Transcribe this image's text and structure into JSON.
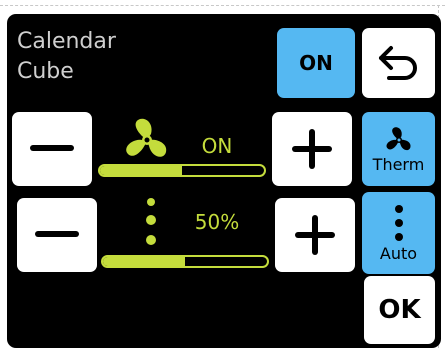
{
  "header": {
    "title": "Calendar\nCube"
  },
  "top_buttons": {
    "power_label": "ON"
  },
  "fan_row": {
    "status": "ON",
    "level_fraction": 0.5
  },
  "mode_row": {
    "status": "50%",
    "level_fraction": 0.5
  },
  "side_buttons": {
    "therm_label": "Therm",
    "auto_label": "Auto"
  },
  "footer": {
    "ok_label": "OK"
  },
  "colors": {
    "accent": "#c4dc3c",
    "highlight": "#55b8f2",
    "background": "#000000",
    "button": "#ffffff"
  },
  "icons": {
    "back": "undo-arrow-icon",
    "fan": "fan-icon",
    "dots": "vertical-dots-icon",
    "minus": "minus-icon",
    "plus": "plus-icon"
  }
}
